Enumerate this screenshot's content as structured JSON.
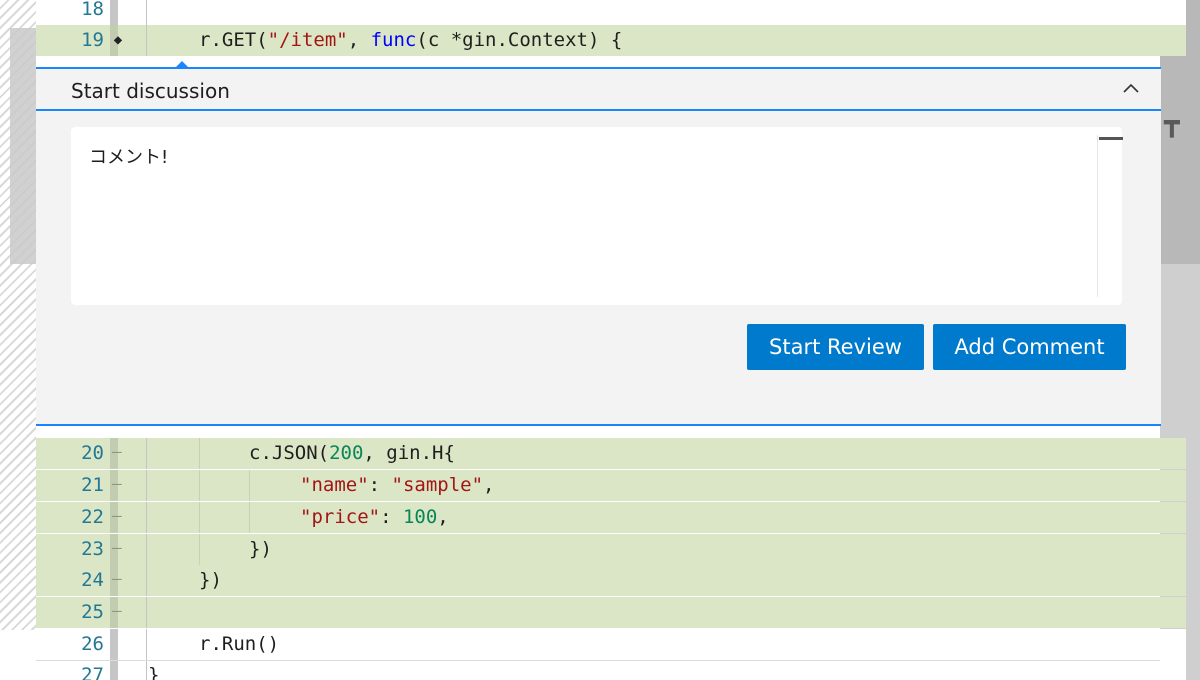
{
  "code_lines_top": [
    {
      "line": "18",
      "marker": "",
      "changed": false
    },
    {
      "line": "19",
      "marker": "◆",
      "changed": true
    }
  ],
  "code": {
    "l19": {
      "a": "r.GET(",
      "b": "\"/item\"",
      "c": ", ",
      "d": "func",
      "e": "(c *gin.Context) {"
    },
    "l20": {
      "num": "20",
      "a": "c.JSON(",
      "b": "200",
      "c": ", gin.H{"
    },
    "l21": {
      "num": "21",
      "a": "\"name\"",
      "b": ": ",
      "c": "\"sample\"",
      "d": ","
    },
    "l22": {
      "num": "22",
      "a": "\"price\"",
      "b": ": ",
      "c": "100",
      "d": ","
    },
    "l23": {
      "num": "23",
      "a": "})"
    },
    "l24": {
      "num": "24",
      "a": "})"
    },
    "l25": {
      "num": "25"
    },
    "l26": {
      "num": "26",
      "a": "r.Run()"
    },
    "l27": {
      "num": "27",
      "a": "}"
    }
  },
  "discussion": {
    "title": "Start discussion",
    "comment_text": "コメント!",
    "start_review_label": "Start Review",
    "add_comment_label": "Add Comment",
    "collapse_icon": "chevron-up-icon"
  },
  "colors": {
    "accent": "#1a85ff",
    "button": "#007acc",
    "added_line": "#dbe6c6",
    "line_number": "#237893",
    "string": "#a31515",
    "keyword": "#0000ff",
    "number": "#098658"
  }
}
